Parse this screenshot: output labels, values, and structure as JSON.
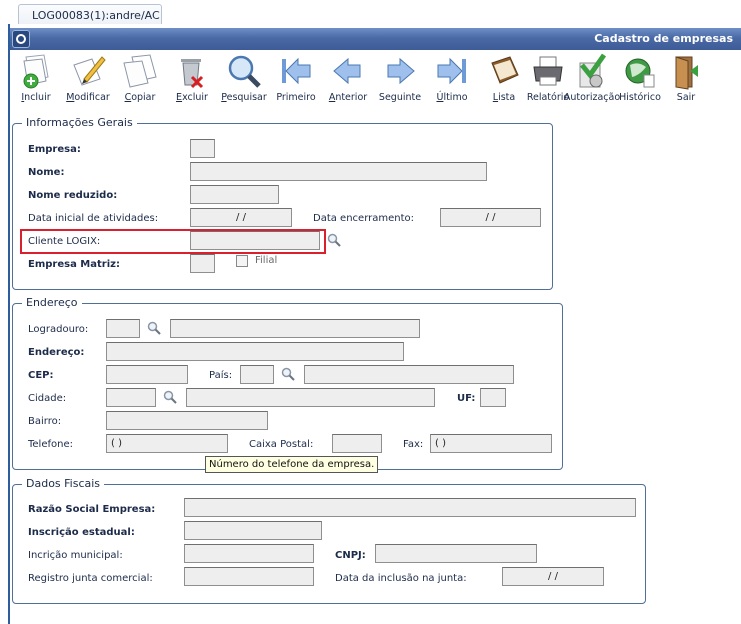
{
  "tab": {
    "label": "LOG00083(1):andre/AC"
  },
  "window": {
    "title": "Cadastro de empresas"
  },
  "toolbar": {
    "incluir": "Incluir",
    "modificar": "Modificar",
    "copiar": "Copiar",
    "excluir": "Excluir",
    "pesquisar": "Pesquisar",
    "primeiro": "Primeiro",
    "anterior": "Anterior",
    "seguinte": "Seguinte",
    "ultimo": "Último",
    "lista": "Lista",
    "relatorio": "Relatório",
    "autorizacao": "Autorização",
    "historico": "Histórico",
    "sair": "Sair"
  },
  "informacoes_gerais": {
    "legend": "Informações Gerais",
    "empresa_label": "Empresa:",
    "nome_label": "Nome:",
    "nome_reduzido_label": "Nome reduzido:",
    "data_inicial_label": "Data inicial de atividades:",
    "data_inicial_value": " / /",
    "data_encerramento_label": "Data encerramento:",
    "data_encerramento_value": " / /",
    "cliente_logix_label": "Cliente LOGIX:",
    "empresa_matriz_label": "Empresa Matriz:",
    "filial_label": "Filial"
  },
  "endereco": {
    "legend": "Endereço",
    "logradouro_label": "Logradouro:",
    "endereco_label": "Endereço:",
    "cep_label": "CEP:",
    "pais_label": "País:",
    "cidade_label": "Cidade:",
    "uf_label": "UF:",
    "bairro_label": "Bairro:",
    "telefone_label": "Telefone:",
    "telefone_value": "( )",
    "caixa_postal_label": "Caixa Postal:",
    "fax_label": "Fax:",
    "fax_value": "( )",
    "telefone_tooltip": "Número do telefone da empresa."
  },
  "dados_fiscais": {
    "legend": "Dados Fiscais",
    "razao_social_label": "Razão Social Empresa:",
    "inscricao_estadual_label": "Inscrição estadual:",
    "inscricao_municipal_label": "Incrição municipal:",
    "cnpj_label": "CNPJ:",
    "registro_junta_label": "Registro junta comercial:",
    "data_inclusao_label": "Data da inclusão na junta:",
    "data_inclusao_value": " / /"
  },
  "colors": {
    "title_bar": "#4a6aa6",
    "group_border": "#4f6f96",
    "highlight": "#d9202f",
    "tooltip_bg": "#ffffe1"
  }
}
